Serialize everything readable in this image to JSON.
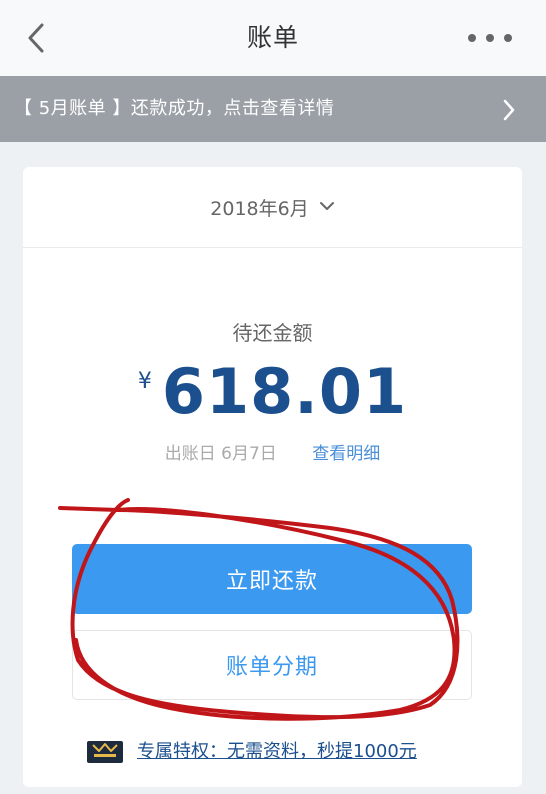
{
  "navbar": {
    "title": "账单",
    "back_icon": "chevron-left-icon",
    "more_icon": "more-dots-icon"
  },
  "notice": {
    "text": "【 5月账单 】还款成功，点击查看详情",
    "arrow_icon": "chevron-right-icon"
  },
  "bill": {
    "month": "2018年6月",
    "due_label": "待还金额",
    "currency": "¥",
    "amount": "618.01",
    "bill_date": "出账日  6月7日",
    "view_detail": "查看明细",
    "repay_button": "立即还款",
    "installment_button": "账单分期",
    "privilege_text": "专属特权：无需资料，秒提1000元",
    "privilege_icon": "crown-card-icon"
  },
  "colors": {
    "accent_blue": "#3c99f0",
    "amount_navy": "#1b4f8e",
    "notice_gray": "#9ba0a7",
    "annotation_red": "#c0161a"
  }
}
